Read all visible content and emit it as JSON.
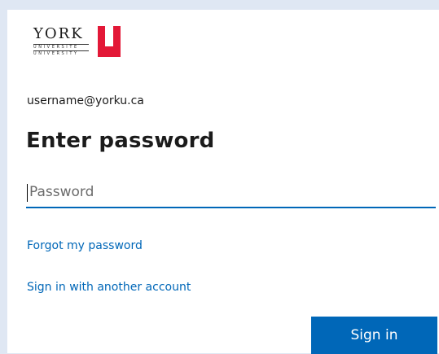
{
  "brand": {
    "logo_text": "YORK",
    "logo_subtext": "UNIVERSITE UNIVERSITY",
    "accent_color": "#e31837",
    "primary_color": "#0067b8"
  },
  "form": {
    "username": "username@yorku.ca",
    "title": "Enter password",
    "password_placeholder": "Password",
    "password_value": "",
    "forgot_link": "Forgot my password",
    "other_account_link": "Sign in with another account",
    "signin_label": "Sign in"
  }
}
